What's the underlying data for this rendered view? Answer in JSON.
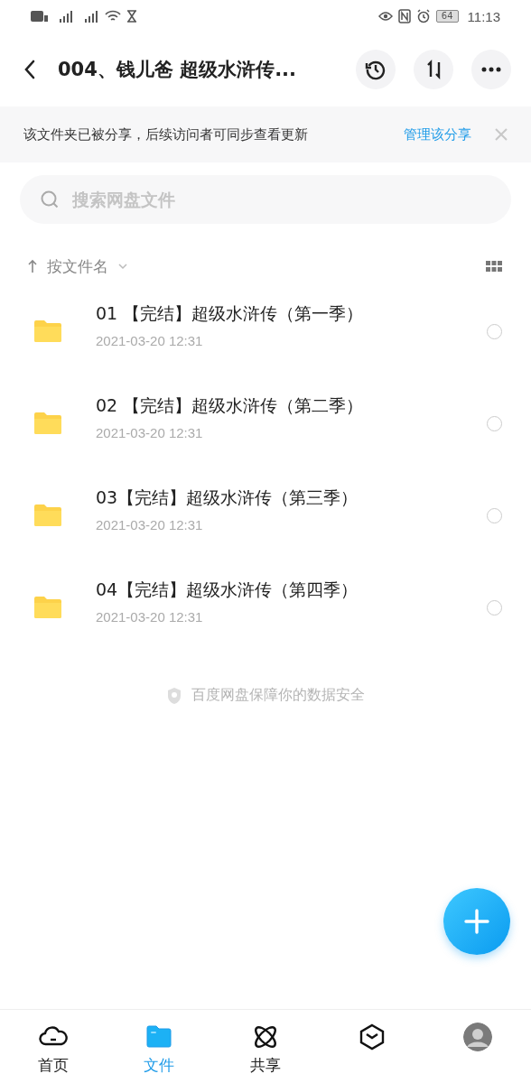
{
  "status_bar": {
    "time": "11:13",
    "battery": "64"
  },
  "header": {
    "title": "004、钱儿爸 超级水浒传..."
  },
  "notice": {
    "text": "该文件夹已被分享，后续访问者可同步查看更新",
    "action": "管理该分享"
  },
  "search": {
    "placeholder": "搜索网盘文件"
  },
  "sort": {
    "label": "按文件名"
  },
  "files": [
    {
      "name": "01 【完结】超级水浒传（第一季）",
      "date": "2021-03-20  12:31",
      "selected": false
    },
    {
      "name": "02 【完结】超级水浒传（第二季）",
      "date": "2021-03-20  12:31",
      "selected": false
    },
    {
      "name": "03【完结】超级水浒传（第三季）",
      "date": "2021-03-20  12:31",
      "selected": false
    },
    {
      "name": "04【完结】超级水浒传（第四季）",
      "date": "2021-03-20  12:31",
      "selected": false
    }
  ],
  "footer_note": "百度网盘保障你的数据安全",
  "nav": [
    {
      "kind": "cloud",
      "label": "首页",
      "selected": false
    },
    {
      "kind": "folder",
      "label": "文件",
      "selected": true
    },
    {
      "kind": "atom",
      "label": "共享",
      "selected": false
    },
    {
      "kind": "cube",
      "selected": false
    },
    {
      "kind": "avatar",
      "selected": false
    }
  ]
}
